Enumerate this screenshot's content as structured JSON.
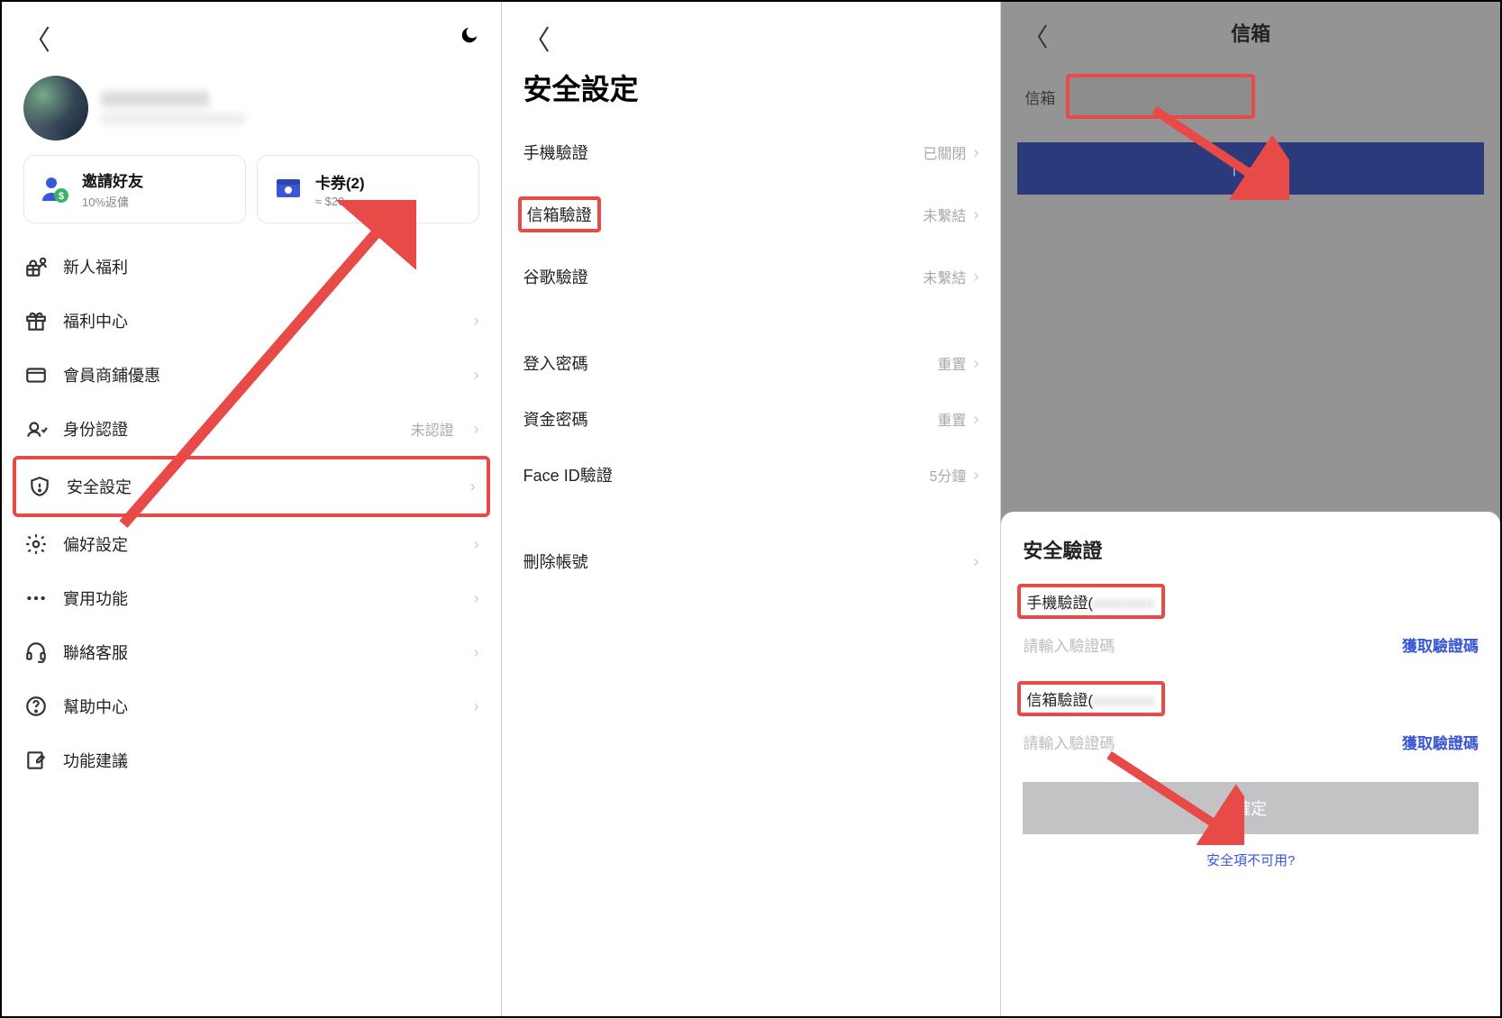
{
  "panel1": {
    "cards": {
      "invite": {
        "title": "邀請好友",
        "sub": "10%返傭"
      },
      "coupon": {
        "title": "卡券(2)",
        "sub": "≈ $20"
      }
    },
    "menu": [
      {
        "icon": "gift-person-icon",
        "label": "新人福利",
        "value": "",
        "arrow": false
      },
      {
        "icon": "gift-icon",
        "label": "福利中心",
        "value": "",
        "arrow": true
      },
      {
        "icon": "card-icon",
        "label": "會員商鋪優惠",
        "value": "",
        "arrow": true
      },
      {
        "icon": "id-icon",
        "label": "身份認證",
        "value": "未認證",
        "arrow": true
      },
      {
        "icon": "shield-icon",
        "label": "安全設定",
        "value": "",
        "arrow": true,
        "highlight": true
      },
      {
        "icon": "gear-icon",
        "label": "偏好設定",
        "value": "",
        "arrow": true
      },
      {
        "icon": "dots-icon",
        "label": "實用功能",
        "value": "",
        "arrow": true
      },
      {
        "icon": "headset-icon",
        "label": "聯絡客服",
        "value": "",
        "arrow": true
      },
      {
        "icon": "question-icon",
        "label": "幫助中心",
        "value": "",
        "arrow": true
      },
      {
        "icon": "edit-icon",
        "label": "功能建議",
        "value": "",
        "arrow": false
      }
    ]
  },
  "panel2": {
    "title": "安全設定",
    "groups": [
      [
        {
          "label": "手機驗證",
          "value": "已關閉"
        },
        {
          "label": "信箱驗證",
          "value": "未繫結",
          "highlight": true
        },
        {
          "label": "谷歌驗證",
          "value": "未繫結"
        }
      ],
      [
        {
          "label": "登入密碼",
          "value": "重置"
        },
        {
          "label": "資金密碼",
          "value": "重置"
        },
        {
          "label": "Face ID驗證",
          "value": "5分鐘"
        }
      ],
      [
        {
          "label": "刪除帳號",
          "value": ""
        }
      ]
    ]
  },
  "panel3": {
    "header_title": "信箱",
    "email_label": "信箱",
    "next_button": "下一步",
    "sheet": {
      "title": "安全驗證",
      "phone_label": "手機驗證(",
      "email_label": "信箱驗證(",
      "placeholder": "請輸入驗證碼",
      "get_code": "獲取驗證碼",
      "confirm": "確定",
      "unavailable": "安全項不可用?"
    }
  }
}
